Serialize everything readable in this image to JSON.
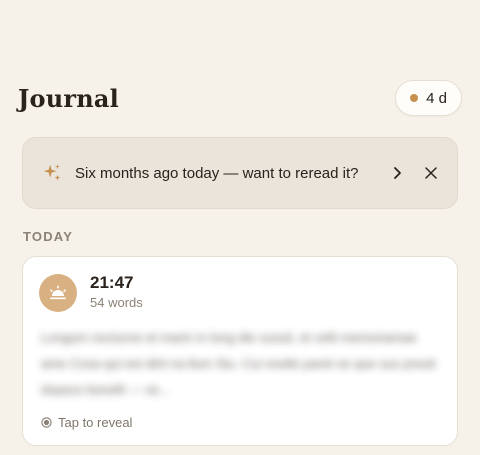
{
  "header": {
    "title": "Journal",
    "streak_label": "4 d"
  },
  "banner": {
    "icon": "sparkle-icon",
    "text": "Six months ago today — want to reread it?"
  },
  "section": {
    "label": "TODAY"
  },
  "entry": {
    "time": "21:47",
    "word_count": "54 words",
    "mood_icon": "sunset-icon",
    "preview_blurred": "Longum nocturne et marin in long die sussit, et velit memoriamae ame Cosa qui est dirit na llum Siu. Cui nostle paret se que sus preuit dopezo bonelli — ve...",
    "reveal_label": "Tap to reveal"
  },
  "colors": {
    "background": "#f6f2ea",
    "accent": "#c7904f",
    "avatar": "#d8b081"
  }
}
